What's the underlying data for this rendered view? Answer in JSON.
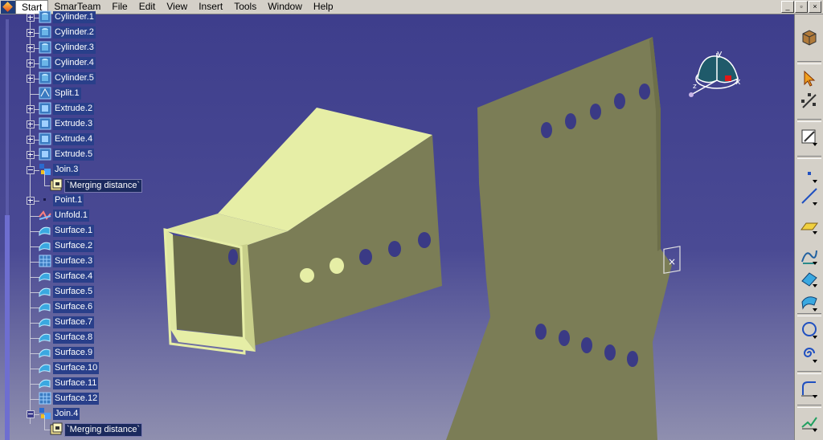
{
  "menu": {
    "items": [
      "Start",
      "SmarTeam",
      "File",
      "Edit",
      "View",
      "Insert",
      "Tools",
      "Window",
      "Help"
    ],
    "active": "Start"
  },
  "window_buttons": [
    "_",
    "▫",
    "×"
  ],
  "tree": {
    "rows": [
      {
        "label": "Cylinder.1",
        "icon": "cylinder-icon",
        "indent": 0,
        "expander": "plus",
        "style": "sel"
      },
      {
        "label": "Cylinder.2",
        "icon": "cylinder-icon",
        "indent": 0,
        "expander": "plus",
        "style": "sel"
      },
      {
        "label": "Cylinder.3",
        "icon": "cylinder-icon",
        "indent": 0,
        "expander": "plus",
        "style": "sel"
      },
      {
        "label": "Cylinder.4",
        "icon": "cylinder-icon",
        "indent": 0,
        "expander": "plus",
        "style": "sel"
      },
      {
        "label": "Cylinder.5",
        "icon": "cylinder-icon",
        "indent": 0,
        "expander": "plus",
        "style": "sel"
      },
      {
        "label": "Split.1",
        "icon": "split-icon",
        "indent": 0,
        "expander": "none",
        "style": "sel"
      },
      {
        "label": "Extrude.2",
        "icon": "extrude-icon",
        "indent": 0,
        "expander": "plus",
        "style": "sel"
      },
      {
        "label": "Extrude.3",
        "icon": "extrude-icon",
        "indent": 0,
        "expander": "plus",
        "style": "sel"
      },
      {
        "label": "Extrude.4",
        "icon": "extrude-icon",
        "indent": 0,
        "expander": "plus",
        "style": "sel"
      },
      {
        "label": "Extrude.5",
        "icon": "extrude-icon",
        "indent": 0,
        "expander": "plus",
        "style": "sel"
      },
      {
        "label": "Join.3",
        "icon": "join-icon",
        "indent": 0,
        "expander": "minus",
        "style": "sel"
      },
      {
        "label": "`Merging distance`",
        "icon": "parameter-icon",
        "indent": 1,
        "expander": "none",
        "style": "box"
      },
      {
        "label": "Point.1",
        "icon": "point-icon",
        "indent": 0,
        "expander": "plus",
        "style": "sel"
      },
      {
        "label": "Unfold.1",
        "icon": "unfold-icon",
        "indent": 0,
        "expander": "none",
        "style": "sel"
      },
      {
        "label": "Surface.1",
        "icon": "surface-icon",
        "indent": 0,
        "expander": "none",
        "style": "sel"
      },
      {
        "label": "Surface.2",
        "icon": "surface-icon",
        "indent": 0,
        "expander": "none",
        "style": "sel"
      },
      {
        "label": "Surface.3",
        "icon": "surface-grid-icon",
        "indent": 0,
        "expander": "none",
        "style": "sel"
      },
      {
        "label": "Surface.4",
        "icon": "surface-icon",
        "indent": 0,
        "expander": "none",
        "style": "sel"
      },
      {
        "label": "Surface.5",
        "icon": "surface-icon",
        "indent": 0,
        "expander": "none",
        "style": "sel"
      },
      {
        "label": "Surface.6",
        "icon": "surface-icon",
        "indent": 0,
        "expander": "none",
        "style": "sel"
      },
      {
        "label": "Surface.7",
        "icon": "surface-icon",
        "indent": 0,
        "expander": "none",
        "style": "sel"
      },
      {
        "label": "Surface.8",
        "icon": "surface-icon",
        "indent": 0,
        "expander": "none",
        "style": "sel"
      },
      {
        "label": "Surface.9",
        "icon": "surface-icon",
        "indent": 0,
        "expander": "none",
        "style": "sel"
      },
      {
        "label": "Surface.10",
        "icon": "surface-icon",
        "indent": 0,
        "expander": "none",
        "style": "sel"
      },
      {
        "label": "Surface.11",
        "icon": "surface-icon",
        "indent": 0,
        "expander": "none",
        "style": "sel"
      },
      {
        "label": "Surface.12",
        "icon": "surface-grid-icon",
        "indent": 0,
        "expander": "none",
        "style": "sel"
      },
      {
        "label": "Join.4",
        "icon": "join-icon",
        "indent": 0,
        "expander": "minus",
        "style": "sel"
      },
      {
        "label": "`Merging distance`",
        "icon": "parameter-icon",
        "indent": 1,
        "expander": "none",
        "style": "box"
      }
    ]
  },
  "compass": {
    "axis_y": "y",
    "axis_x": "x",
    "axis_z": "z"
  },
  "toolbar": {
    "tools": [
      "sketcher-3d-icon",
      "select-arrow-icon",
      "snap-icon",
      "sketch-icon",
      "point-tool-icon",
      "line-tool-icon",
      "plane-tool-icon",
      "spline-icon",
      "extrude-surface-icon",
      "offset-surface-icon",
      "circle-tool-icon",
      "spiral-tool-icon",
      "corner-tool-icon",
      "law-tool-icon"
    ]
  },
  "colors": {
    "background_top": "#3e3e8c",
    "background_bottom": "#8f8faf",
    "part_dark": "#7b7d56",
    "part_light": "#e6eea6",
    "tree_text": "#ffffff",
    "tree_selection": "#293f8a",
    "toolbar": "#d4d0c8"
  }
}
